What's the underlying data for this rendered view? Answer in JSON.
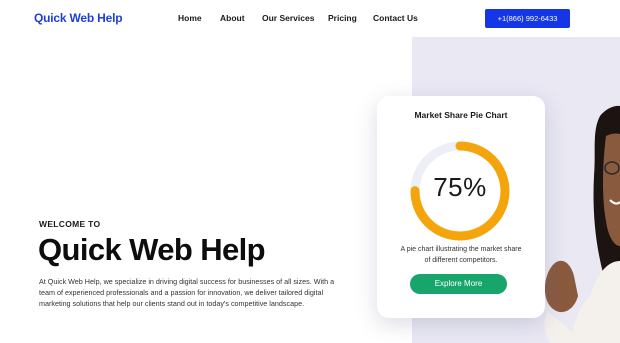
{
  "header": {
    "logo": "Quick Web Help",
    "nav": [
      {
        "label": "Home"
      },
      {
        "label": "About"
      },
      {
        "label": "Our Services"
      },
      {
        "label": "Pricing"
      },
      {
        "label": "Contact Us"
      }
    ],
    "phone": "+1(866) 992-6433"
  },
  "hero": {
    "eyebrow": "WELCOME TO",
    "title": "Quick Web Help",
    "description": "At Quick Web Help, we specialize in driving digital success for businesses of all sizes. With a team of experienced professionals and a passion for innovation, we deliver tailored digital marketing solutions that help our clients stand out in today's competitive landscape."
  },
  "card": {
    "title": "Market Share Pie Chart",
    "value_label": "75%",
    "value_fraction": 0.75,
    "caption": "A pie chart illustrating the market share of different competitors.",
    "button": "Explore More"
  },
  "colors": {
    "brand": "#1f3fd8",
    "phone_button": "#1436e6",
    "ring_fill": "#f5a50c",
    "ring_track": "#eceff6",
    "explore_button": "#17a56c",
    "hero_panel": "#e9e8f3"
  }
}
